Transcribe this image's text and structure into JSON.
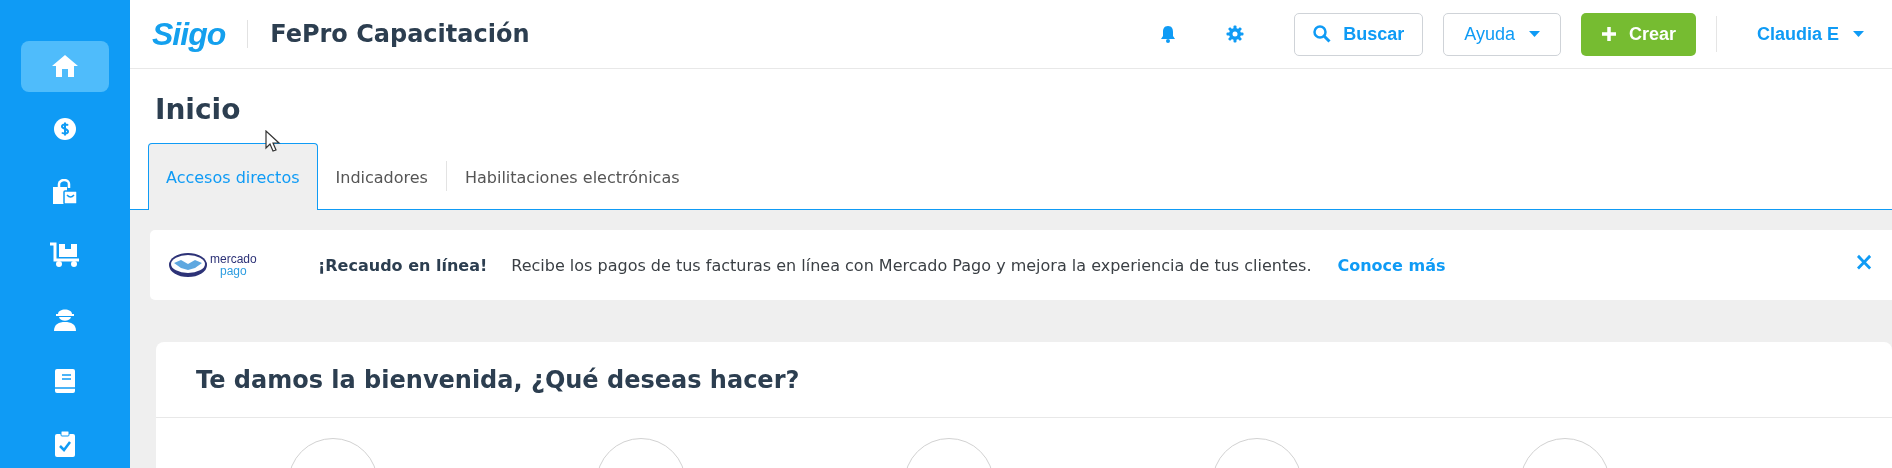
{
  "sidebar": {
    "items": [
      {
        "kind": "home",
        "selected": true
      },
      {
        "kind": "money",
        "selected": false
      },
      {
        "kind": "bag",
        "selected": false
      },
      {
        "kind": "cart",
        "selected": false
      },
      {
        "kind": "worker",
        "selected": false
      },
      {
        "kind": "book",
        "selected": false
      },
      {
        "kind": "clipboard",
        "selected": false
      }
    ]
  },
  "header": {
    "logo": "Siigo",
    "company": "FePro Capacitación",
    "search_button": "Buscar",
    "help_button": "Ayuda",
    "create_button": "Crear",
    "user": "Claudia E"
  },
  "page": {
    "title": "Inicio"
  },
  "tabs": [
    {
      "label": "Accesos directos",
      "selected": true
    },
    {
      "label": "Indicadores",
      "selected": false
    },
    {
      "label": "Habilitaciones electrónicas",
      "selected": false
    }
  ],
  "banner": {
    "logo_top": "mercado",
    "logo_bottom": "pago",
    "title": "¡Recaudo en línea!",
    "text": "Recibe los pagos de tus facturas en línea con Mercado Pago y mejora la experiencia de tus clientes.",
    "link": "Conoce más",
    "close": "×"
  },
  "welcome": {
    "title": "Te damos la bienvenida, ¿Qué deseas hacer?"
  }
}
